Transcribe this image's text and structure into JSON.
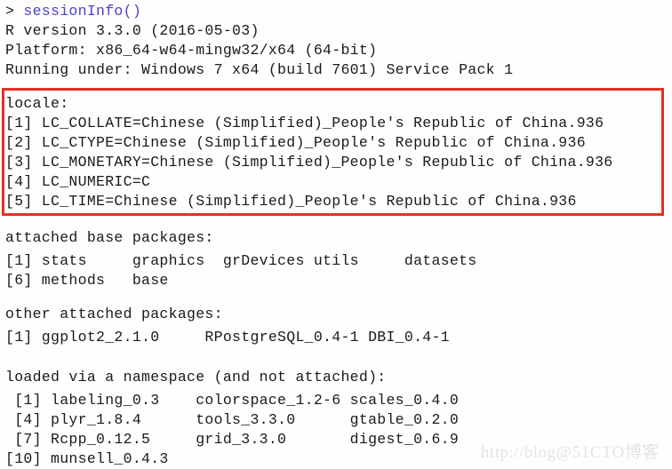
{
  "console": {
    "background_color": "#fffefe",
    "text_color": "#1a1a1a",
    "command_color": "#4b3fcf",
    "prompt_symbol": "> ",
    "command": "sessionInfo()",
    "lines": [
      "R version 3.3.0 (2016-05-03)",
      "Platform: x86_64-w64-mingw32/x64 (64-bit)",
      "Running under: Windows 7 x64 (build 7601) Service Pack 1",
      "",
      "locale:",
      "[1] LC_COLLATE=Chinese (Simplified)_People's Republic of China.936",
      "[2] LC_CTYPE=Chinese (Simplified)_People's Republic of China.936",
      "[3] LC_MONETARY=Chinese (Simplified)_People's Republic of China.936",
      "[4] LC_NUMERIC=C",
      "[5] LC_TIME=Chinese (Simplified)_People's Republic of China.936",
      "",
      "attached base packages:",
      "[1] stats     graphics  grDevices utils     datasets",
      "[6] methods   base",
      "",
      "other attached packages:",
      "[1] ggplot2_2.1.0     RPostgreSQL_0.4-1 DBI_0.4-1",
      "",
      "loaded via a namespace (and not attached):",
      " [1] labeling_0.3    colorspace_1.2-6 scales_0.4.0",
      " [4] plyr_1.8.4      tools_3.3.0      gtable_0.2.0",
      " [7] Rcpp_0.12.5     grid_3.3.0       digest_0.6.9",
      "[10] munsell_0.4.3"
    ]
  },
  "annotation": {
    "highlight_color": "#e03127",
    "highlight_label": "locale block highlight"
  },
  "watermark": {
    "text": "http://blog@51CTO博客",
    "color": "#e6e2e2"
  }
}
